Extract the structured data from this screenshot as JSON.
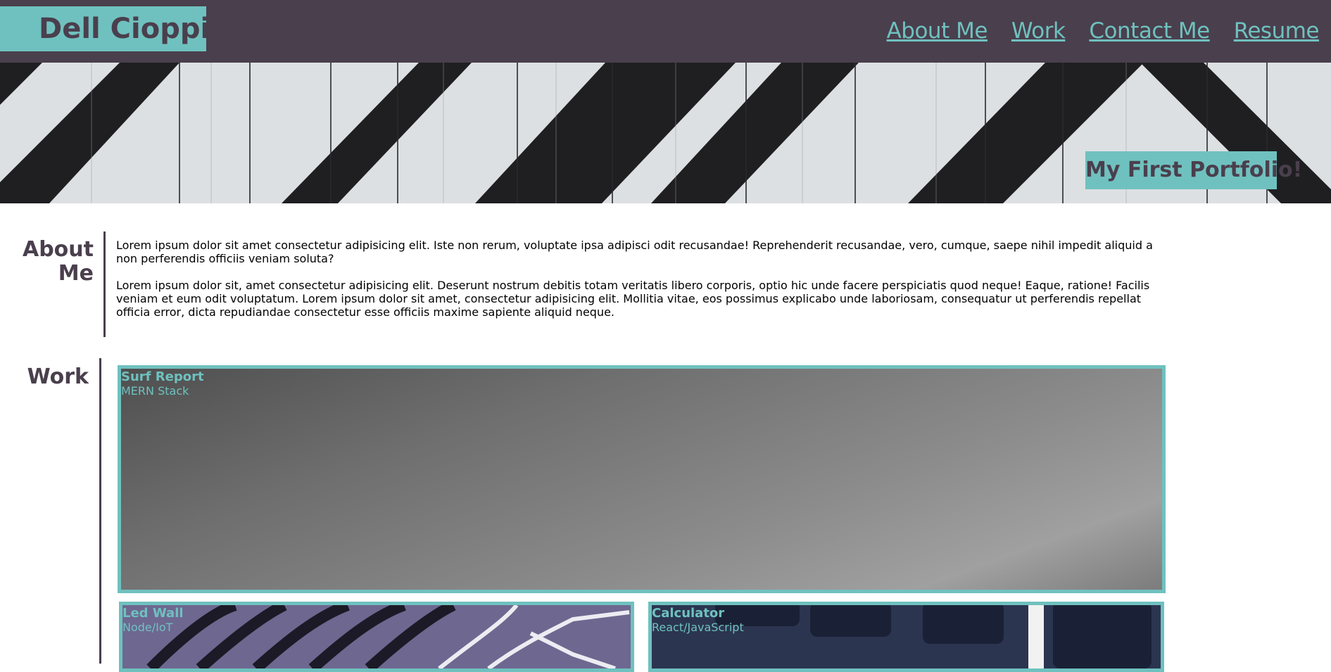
{
  "header": {
    "brand": "Dell Cioppia",
    "nav": [
      "About Me",
      "Work",
      "Contact Me",
      "Resume"
    ]
  },
  "hero": {
    "tagline": "My First Portfolio!"
  },
  "about": {
    "title": "About Me",
    "paragraphs": [
      "Lorem ipsum dolor sit amet consectetur adipisicing elit. Iste non rerum, voluptate ipsa adipisci odit recusandae! Reprehenderit recusandae, vero, cumque, saepe nihil impedit aliquid a non perferendis officiis veniam soluta?",
      "Lorem ipsum dolor sit, amet consectetur adipisicing elit. Deserunt nostrum debitis totam veritatis libero corporis, optio hic unde facere perspiciatis quod neque! Eaque, ratione! Facilis veniam et eum odit voluptatum. Lorem ipsum dolor sit amet, consectetur adipisicing elit. Mollitia vitae, eos possimus explicabo unde laboriosam, consequatur ut perferendis repellat officia error, dicta repudiandae consectetur esse officiis maxime sapiente aliquid neque."
    ]
  },
  "work": {
    "title": "Work",
    "projects": [
      {
        "name": "Surf Report",
        "stack": "MERN Stack"
      },
      {
        "name": "Led Wall",
        "stack": "Node/IoT"
      },
      {
        "name": "Calculator",
        "stack": "React/JavaScript"
      }
    ]
  },
  "colors": {
    "header_bg": "#4a3f4d",
    "accent": "#6fc1bf"
  }
}
